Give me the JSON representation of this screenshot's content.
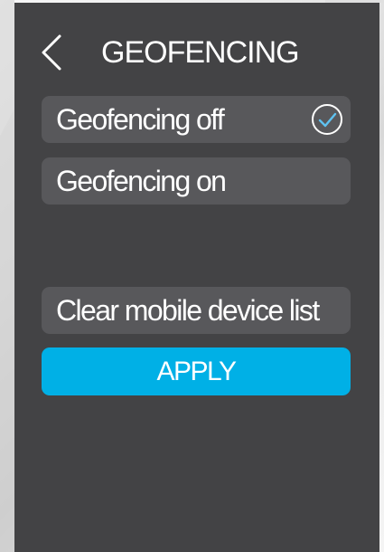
{
  "header": {
    "back_icon": "chevron-left-icon",
    "title": "GEOFENCING"
  },
  "options": [
    {
      "label": "Geofencing off",
      "selected": true,
      "check_icon": "check-circle-icon"
    },
    {
      "label": "Geofencing on",
      "selected": false
    }
  ],
  "actions": {
    "clear_label": "Clear mobile device list",
    "apply_label": "APPLY"
  },
  "colors": {
    "panel_background": "#434345",
    "option_background": "#58585b",
    "accent": "#00b0e6",
    "text": "#ffffff",
    "check": "#5fc2f0"
  }
}
